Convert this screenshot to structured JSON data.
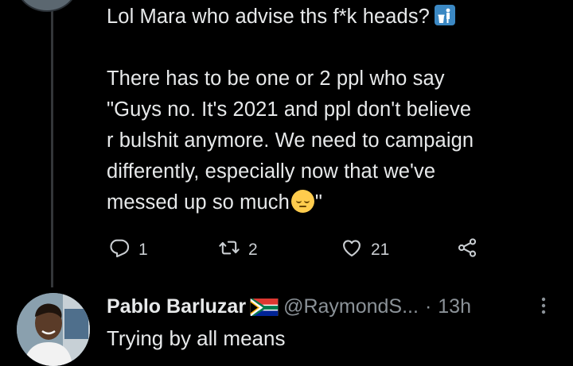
{
  "tweet": {
    "line1": "Lol Mara who advise ths f*k heads?",
    "body_main": "There has to be one or 2 ppl who say\n\"Guys no. It's 2021 and ppl don't believe\nr bulshit anymore. We need to campaign\ndifferently, especially now that we've\nmessed up so much",
    "body_end": "\"",
    "reply_count": "1",
    "retweet_count": "2",
    "like_count": "21"
  },
  "reply": {
    "name": "Pablo Barluzar",
    "handle": "@RaymondS...",
    "separator": "·",
    "time": "13h",
    "text": "Trying by all means"
  },
  "colors": {
    "background": "#000000",
    "text": "#e7e9ea",
    "secondary": "#8b9298"
  }
}
